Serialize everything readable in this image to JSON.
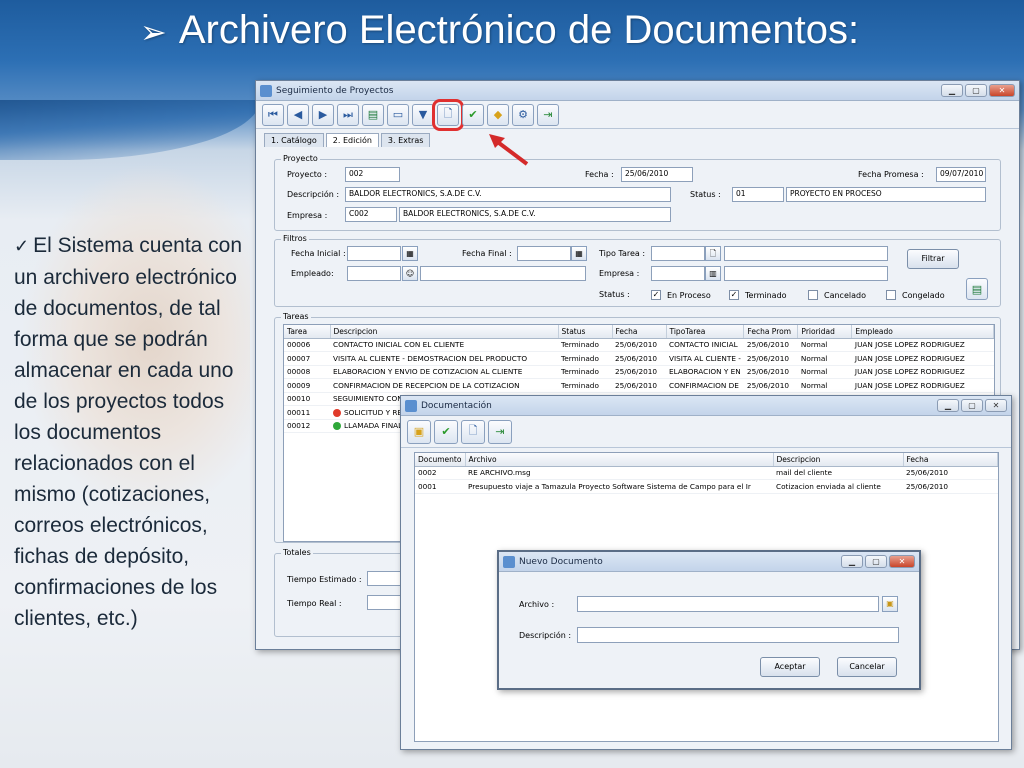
{
  "slide": {
    "title": "Archivero Electrónico de Documentos:",
    "title_bullet": "➢",
    "check": "✓",
    "body": "El Sistema cuenta con un archivero electrónico de documentos, de tal forma que se podrán almacenar en cada uno de los proyectos todos los documentos relacionados con el mismo (cotizaciones, correos electrónicos, fichas de depósito, confirmaciones de los clientes, etc.)"
  },
  "main_window": {
    "title": "Seguimiento de Proyectos",
    "toolbar_icons": [
      "first-icon",
      "prev-icon",
      "next-icon",
      "last-icon",
      "excel-icon",
      "blank-icon",
      "filter-icon",
      "document-icon",
      "check-icon",
      "box-icon",
      "gear-icon",
      "exit-icon"
    ],
    "tabs": [
      "1. Catálogo",
      "2. Edición",
      "3. Extras"
    ],
    "proyecto": {
      "group": "Proyecto",
      "proyecto_label": "Proyecto :",
      "proyecto_value": "002",
      "fecha_label": "Fecha :",
      "fecha_value": "25/06/2010",
      "fecha_promesa_label": "Fecha Promesa :",
      "fecha_promesa_value": "09/07/2010",
      "descripcion_label": "Descripción :",
      "descripcion_value": "BALDOR ELECTRONICS, S.A.DE C.V.",
      "status_label": "Status :",
      "status_code": "01",
      "status_value": "PROYECTO EN PROCESO",
      "empresa_label": "Empresa :",
      "empresa_code": "C002",
      "empresa_value": "BALDOR ELECTRONICS, S.A.DE C.V."
    },
    "filtros": {
      "group": "Filtros",
      "fecha_inicial": "Fecha Inicial :",
      "fecha_final": "Fecha Final :",
      "tipo_tarea": "Tipo Tarea :",
      "empleado": "Empleado:",
      "empresa": "Empresa :",
      "status": "Status :",
      "filtrar": "Filtrar",
      "checks": [
        {
          "label": "En Proceso",
          "checked": "✓"
        },
        {
          "label": "Terminado",
          "checked": "✓"
        },
        {
          "label": "Cancelado",
          "checked": ""
        },
        {
          "label": "Congelado",
          "checked": ""
        }
      ]
    },
    "tareas": {
      "group": "Tareas",
      "columns": [
        "Tarea",
        "Descripcion",
        "Status",
        "Fecha",
        "TipoTarea",
        "Fecha Prom",
        "Prioridad",
        "Empleado"
      ],
      "rows": [
        {
          "tarea": "00006",
          "desc": "CONTACTO INICIAL CON EL CLIENTE",
          "status": "Terminado",
          "fecha": "25/06/2010",
          "tipo": "CONTACTO INICIAL",
          "fprom": "25/06/2010",
          "prio": "Normal",
          "emp": "JUAN JOSE LOPEZ RODRIGUEZ"
        },
        {
          "tarea": "00007",
          "desc": "VISITA AL CLIENTE - DEMOSTRACION DEL PRODUCTO",
          "status": "Terminado",
          "fecha": "25/06/2010",
          "tipo": "VISITA AL CLIENTE -",
          "fprom": "25/06/2010",
          "prio": "Normal",
          "emp": "JUAN JOSE LOPEZ RODRIGUEZ"
        },
        {
          "tarea": "00008",
          "desc": "ELABORACION Y ENVIO DE COTIZACION AL CLIENTE",
          "status": "Terminado",
          "fecha": "25/06/2010",
          "tipo": "ELABORACION Y EN",
          "fprom": "25/06/2010",
          "prio": "Normal",
          "emp": "JUAN JOSE LOPEZ RODRIGUEZ"
        },
        {
          "tarea": "00009",
          "desc": "CONFIRMACION DE RECEPCION DE LA COTIZACION",
          "status": "Terminado",
          "fecha": "25/06/2010",
          "tipo": "CONFIRMACION DE",
          "fprom": "25/06/2010",
          "prio": "Normal",
          "emp": "JUAN JOSE LOPEZ RODRIGUEZ"
        },
        {
          "tarea": "00010",
          "desc": "SEGUIMIENTO CON",
          "status": "",
          "fecha": "",
          "tipo": "",
          "fprom": "",
          "prio": "",
          "emp": ""
        },
        {
          "tarea": "00011",
          "desc": "SOLICITUD Y RECE",
          "status": "",
          "fecha": "",
          "tipo": "",
          "fprom": "",
          "prio": "",
          "emp": "",
          "dot": "#e03a2a"
        },
        {
          "tarea": "00012",
          "desc": "LLAMADA FINAL AL",
          "status": "",
          "fecha": "",
          "tipo": "",
          "fprom": "",
          "prio": "",
          "emp": "",
          "dot": "#2fa83a"
        }
      ]
    },
    "totales": {
      "group": "Totales",
      "tiempo_estimado": "Tiempo Estimado :",
      "tiempo_real": "Tiempo Real :"
    }
  },
  "doc_window": {
    "title": "Documentación",
    "columns": [
      "Documento",
      "Archivo",
      "Descripcion",
      "Fecha"
    ],
    "rows": [
      {
        "doc": "0002",
        "archivo": "RE ARCHIVO.msg",
        "desc": "mail del cliente",
        "fecha": "25/06/2010"
      },
      {
        "doc": "0001",
        "archivo": "Presupuesto viaje a Tamazula Proyecto Software Sistema de Campo para el Ir",
        "desc": "Cotizacion enviada al cliente",
        "fecha": "25/06/2010"
      }
    ]
  },
  "nuevo_window": {
    "title": "Nuevo Documento",
    "archivo_label": "Archivo :",
    "descripcion_label": "Descripción :",
    "aceptar": "Aceptar",
    "cancelar": "Cancelar"
  },
  "colors": {
    "highlight": "#e03030",
    "title_bar": "#2c6fb4"
  }
}
